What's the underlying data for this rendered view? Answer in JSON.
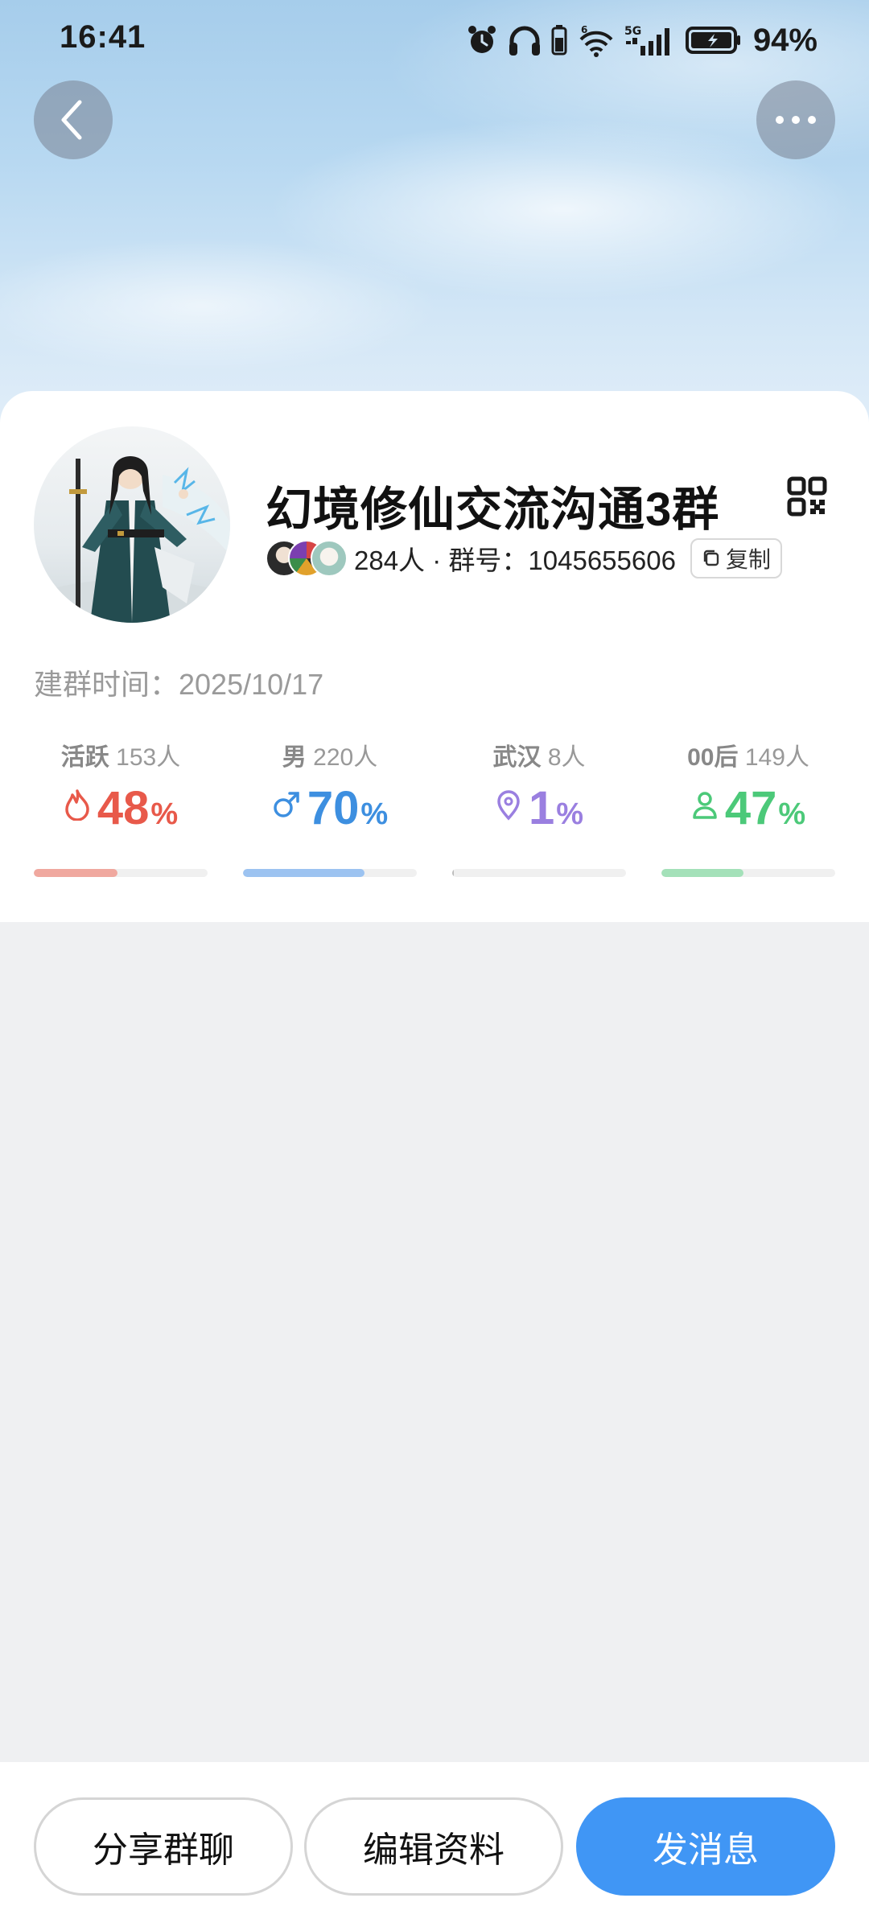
{
  "status_bar": {
    "time": "16:41",
    "battery": "94%",
    "icons": [
      "alarm-icon",
      "headphones-icon",
      "phone-battery-icon",
      "wifi-icon",
      "signal-5g-icon",
      "battery-icon"
    ]
  },
  "nav": {
    "back_icon": "chevron-left-icon",
    "more_icon": "more-dots-icon"
  },
  "group": {
    "name": "幻境修仙交流沟通3群",
    "member_count": "284人",
    "separator": "·",
    "id_label": "群号：",
    "id": "1045655606",
    "copy_label": "复制",
    "created_label": "建群时间：",
    "created_date": "2025/10/17"
  },
  "stats": [
    {
      "label": "活跃",
      "count": "153人",
      "value": "48",
      "unit": "%",
      "fraction": 0.48,
      "color": "#e8594a",
      "track_color": "#f0a89f",
      "icon": "flame-icon"
    },
    {
      "label": "男",
      "count": "220人",
      "value": "70",
      "unit": "%",
      "fraction": 0.7,
      "color": "#3d8fe0",
      "track_color": "#9cc3f1",
      "icon": "male-icon"
    },
    {
      "label": "武汉",
      "count": "8人",
      "value": "1",
      "unit": "%",
      "fraction": 0.01,
      "color": "#9a7fe0",
      "track_color": "#c9b8f2",
      "icon": "location-pin-icon"
    },
    {
      "label": "00后",
      "count": "149人",
      "value": "47",
      "unit": "%",
      "fraction": 0.47,
      "color": "#4cc979",
      "track_color": "#a4e1b9",
      "icon": "person-icon"
    }
  ],
  "actions": {
    "share": "分享群聊",
    "edit": "编辑资料",
    "send": "发消息"
  },
  "colors": {
    "accent": "#4096f5",
    "background": "#eff0f2"
  }
}
